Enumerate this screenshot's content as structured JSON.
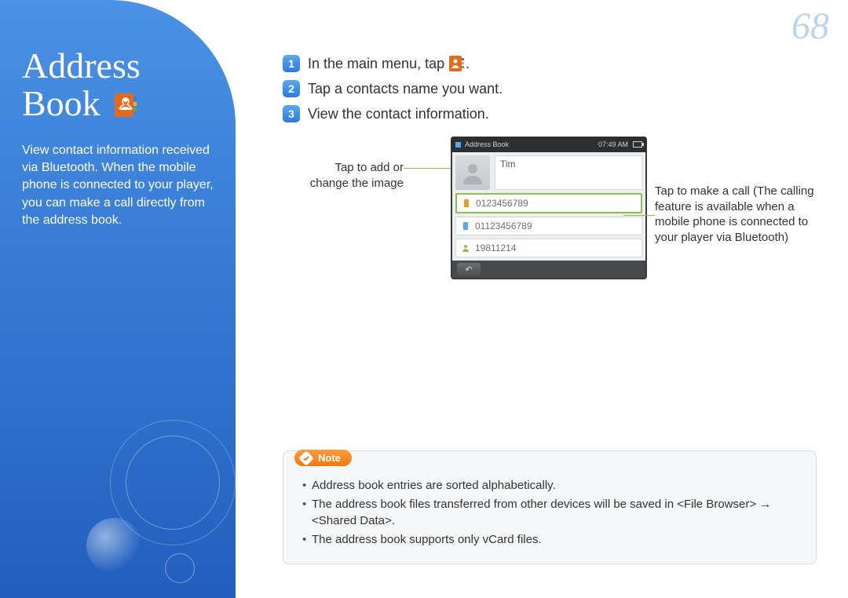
{
  "page_number": "68",
  "sidebar": {
    "title_line1": "Address",
    "title_line2": "Book",
    "description": "View contact information received via Bluetooth. When the mobile phone is connected to your player, you can make a call directly from the address book."
  },
  "steps": [
    {
      "num": "1",
      "text_before": "In the main menu, tap ",
      "text_after": "."
    },
    {
      "num": "2",
      "text": "Tap a contacts name you want."
    },
    {
      "num": "3",
      "text": "View the contact information."
    }
  ],
  "captions": {
    "left": "Tap to add or change the image",
    "right": "Tap to make a call (The calling feature is available when a mobile phone is connected to your player via Bluetooth)"
  },
  "device": {
    "header_title": "Address Book",
    "time": "07:49 AM",
    "contact_name": "Tim",
    "entries": [
      {
        "icon": "mobile-orange",
        "value": "0123456789",
        "highlight": true
      },
      {
        "icon": "mobile-blue",
        "value": "01123456789",
        "highlight": false
      },
      {
        "icon": "person-green",
        "value": "19811214",
        "highlight": false
      }
    ]
  },
  "note": {
    "label": "Note",
    "items": [
      "Address book entries are sorted alphabetically.",
      "The address book files transferred from other devices will be saved in <File Browser> → <Shared Data>.",
      "The address book supports only vCard files."
    ]
  }
}
